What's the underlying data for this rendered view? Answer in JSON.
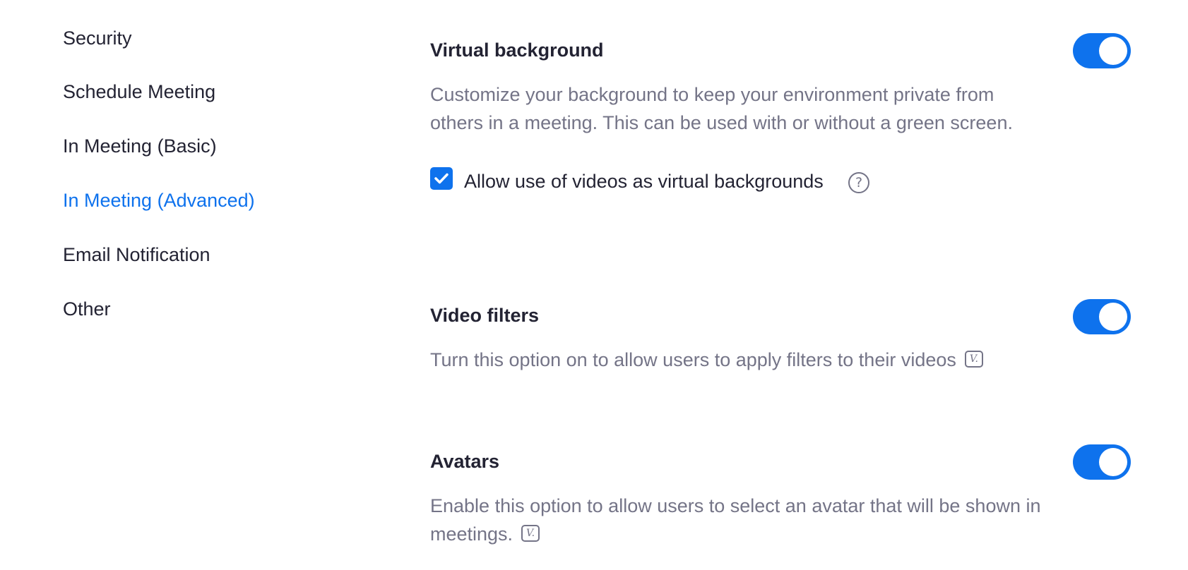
{
  "sidebar": {
    "items": [
      {
        "label": "Security",
        "active": false
      },
      {
        "label": "Schedule Meeting",
        "active": false
      },
      {
        "label": "In Meeting (Basic)",
        "active": false
      },
      {
        "label": "In Meeting (Advanced)",
        "active": true
      },
      {
        "label": "Email Notification",
        "active": false
      },
      {
        "label": "Other",
        "active": false
      }
    ]
  },
  "sections": {
    "virtual_background": {
      "title": "Virtual background",
      "description": "Customize your background to keep your environment private from others in a meeting. This can be used with or without a green screen.",
      "enabled": true,
      "option": {
        "label": "Allow use of videos as virtual backgrounds",
        "checked": true,
        "help_icon": "question-circle-icon"
      }
    },
    "video_filters": {
      "title": "Video filters",
      "description": "Turn this option on to allow users to apply filters to their videos",
      "enabled": true,
      "version_icon": "V."
    },
    "avatars": {
      "title": "Avatars",
      "description": "Enable this option to allow users to select an avatar that will be shown in meetings.",
      "enabled": true,
      "version_icon": "V."
    }
  },
  "colors": {
    "accent": "#0e72ed",
    "text_primary": "#232333",
    "text_secondary": "#747487"
  }
}
